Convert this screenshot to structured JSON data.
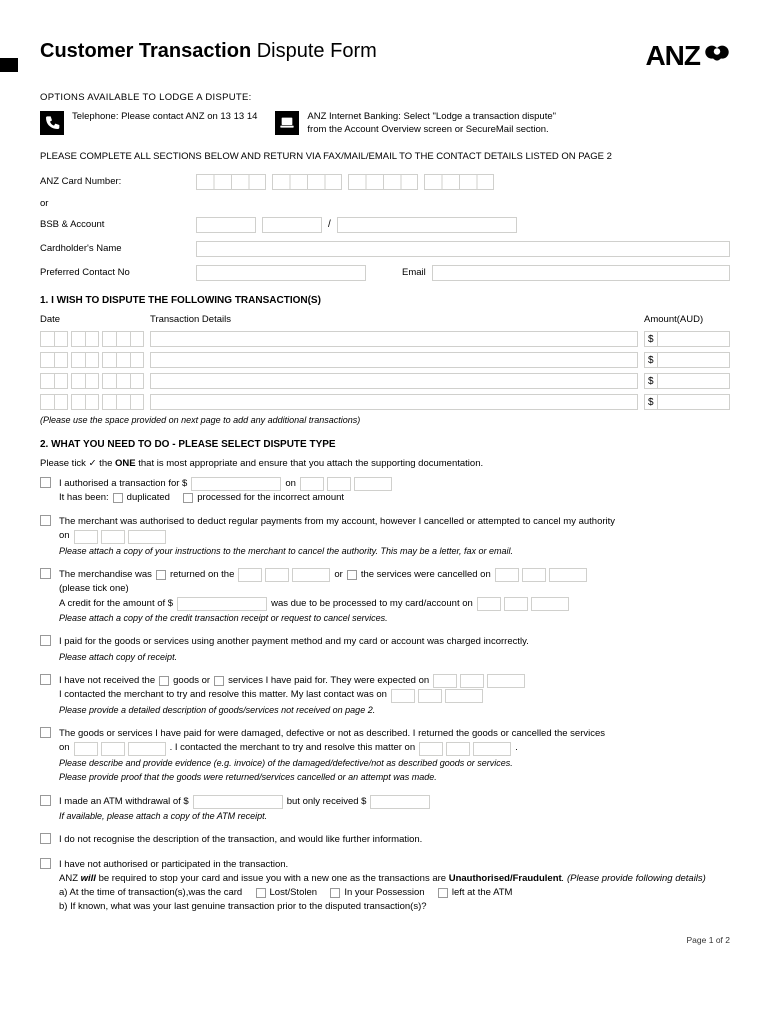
{
  "title_bold": "Customer Transaction",
  "title_rest": " Dispute Form",
  "logo_text": "ANZ",
  "options_label": "OPTIONS AVAILABLE TO LODGE A DISPUTE:",
  "opt_phone": "Telephone: Please contact ANZ on 13 13 14",
  "opt_internet_l1": "ANZ Internet Banking: Select \"Lodge a transaction dispute\"",
  "opt_internet_l2": "from the Account Overview screen or SecureMail section.",
  "instr": "PLEASE COMPLETE ALL SECTIONS BELOW AND RETURN VIA FAX/MAIL/EMAIL TO THE CONTACT DETAILS LISTED ON PAGE 2",
  "labels": {
    "card": "ANZ Card Number:",
    "or": "or",
    "bsb": "BSB & Account",
    "name": "Cardholder's Name",
    "contact": "Preferred Contact No",
    "email": "Email"
  },
  "sec1": "1. I WISH TO DISPUTE THE FOLLOWING TRANSACTION(S)",
  "sec1_cols": {
    "date": "Date",
    "details": "Transaction Details",
    "amount": "Amount(AUD)"
  },
  "sec1_note": "(Please use the space provided on next page to add any additional transactions)",
  "sec2": "2. WHAT YOU NEED TO DO - PLEASE SELECT DISPUTE TYPE",
  "sec2_intro_a": "Please tick ✓ the ",
  "sec2_intro_b": "ONE",
  "sec2_intro_c": " that is most appropriate and ensure that you attach the supporting documentation.",
  "d1": {
    "a": "I authorised a transaction for  $",
    "on": "on",
    "b": "It has been:",
    "dup": "duplicated",
    "proc": "processed for the incorrect amount"
  },
  "d2": {
    "a": "The merchant was authorised to deduct regular payments from my account, however I cancelled or attempted to cancel my authority",
    "on": "on",
    "att": "Please attach a copy of your instructions to the merchant to cancel the authority. This may be a letter, fax or email."
  },
  "d3": {
    "a": "The merchandise was",
    "ret": "returned on the",
    "or": "or",
    "svc": "the services were cancelled on",
    "tick": "(please tick one)",
    "b1": "A credit for the amount of $",
    "b2": "was due to be processed to my card/account on",
    "att": "Please attach a copy of the credit transaction receipt or request to cancel services."
  },
  "d4": {
    "a": "I paid for the goods or services using another payment method and my card or account was charged incorrectly.",
    "att": "Please attach copy of receipt."
  },
  "d5": {
    "a": "I have not received the",
    "goods": "goods or",
    "svc": "services I have paid for. They were expected on",
    "b": "I contacted the merchant to try and resolve this matter. My last contact was on",
    "att": "Please provide a detailed description of goods/services not received on page 2."
  },
  "d6": {
    "a": "The goods or services I have paid for were damaged, defective or not as described. I returned the goods or cancelled the services",
    "on": "on",
    "b": ". I contacted the merchant to try and resolve this matter on",
    "att1": "Please describe and provide evidence (e.g. invoice) of the damaged/defective/not as described goods or services.",
    "att2": "Please provide proof that the goods were returned/services cancelled or an attempt was made."
  },
  "d7": {
    "a": "I made an ATM withdrawal of $",
    "b": "but only received $",
    "att": "If available, please attach a copy of the ATM receipt."
  },
  "d8": "I do not recognise the description of the transaction, and would like further information.",
  "d9": {
    "a": "I have not authorised or participated in the transaction.",
    "b1": "ANZ ",
    "b2": "will",
    "b3": " be required to stop your card and issue you with a new one as the transactions are ",
    "b4": "Unauthorised/Fraudulent",
    "b5": ". (Please provide following details)",
    "qa": "a) At the time of transaction(s),was the card",
    "lost": "Lost/Stolen",
    "poss": "In your Possession",
    "atm": "left at the ATM",
    "qb": "b) If known, what was your last genuine transaction prior to the disputed transaction(s)?"
  },
  "footer": "Page 1 of 2",
  "dollar": "$"
}
